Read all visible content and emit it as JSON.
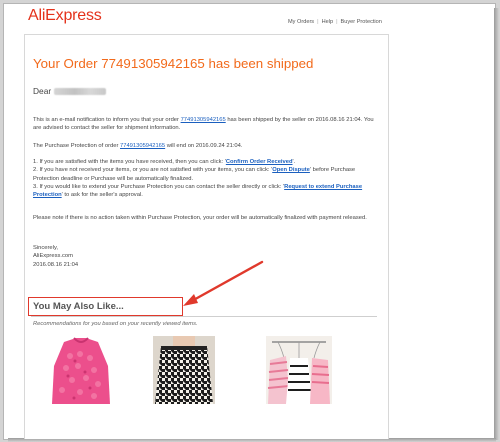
{
  "logo": {
    "text": "AliExpress"
  },
  "nav": {
    "my_orders": "My Orders",
    "help": "Help",
    "buyer_protection": "Buyer Protection",
    "separator": "|"
  },
  "email": {
    "title": "Your Order 77491305942165 has been shipped",
    "dear": "Dear",
    "p1_pre": "This is an e-mail notification to inform you that your order ",
    "p1_order": "77491305942165",
    "p1_post": " has been shipped by the seller on 2016.08.16 21:04. You are advised to contact the seller for shipment information.",
    "p2_pre": "The Purchase Protection of order ",
    "p2_order": "77491305942165",
    "p2_post": " will end on 2016.09.24 21:04.",
    "l1_pre": "1. If you are satisfied with the items you have received, then you can click: '",
    "l1_link": "Confirm Order Received",
    "l1_post": "'.",
    "l2_pre": "2. If you have not received your items, or you are not satisfied with your items, you can click: '",
    "l2_link": "Open Dispute",
    "l2_post": "' before Purchase Protection deadline or Purchase will be automatically finalized.",
    "l3_pre": "3. If you would like to extend your Purchase Protection you can contact the seller directly or click: '",
    "l3_link": "Request to extend Purchase Protection",
    "l3_post": "' to ask for the seller's approval.",
    "note": "Please note if there is no action taken within Purchase Protection, your order will be automatically finalized with payment released.",
    "sign_1": "Sincerely,",
    "sign_2": "AliExpress.com",
    "sign_3": "2016.08.16 21:04"
  },
  "ymal": {
    "title": "You May Also Like...",
    "subtitle": "Recommendations for you based on your recently viewed items."
  },
  "colors": {
    "brand": "#e4321b",
    "title": "#f26a1b",
    "link": "#1a5fbf",
    "annotation": "#e0392c"
  },
  "icons": [
    "red-annotation-arrow"
  ]
}
